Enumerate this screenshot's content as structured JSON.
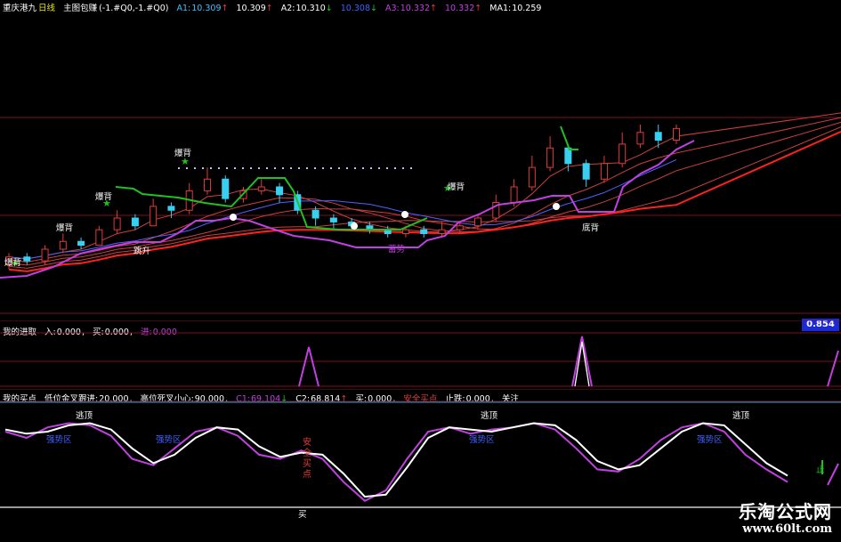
{
  "main_header": {
    "stock": "重庆港九",
    "period": "日线",
    "formula": "主图包赚",
    "params": "(-1.#Q0,-1.#Q0)",
    "a1_label": "A1:",
    "a1_value": "10.309",
    "a1_value2": "10.309",
    "a2_label": "A2:",
    "a2_value": "10.310",
    "blue_value": "10.308",
    "a3_label": "A3:",
    "a3_value": "10.332",
    "a3_value2": "10.332",
    "ma1_label": "MA1:",
    "ma1_value": "10.259"
  },
  "main_annotations": {
    "sell_label": "爆背",
    "buy_label": "底背",
    "rise_label": "跳升",
    "rebound_label": "蓄势"
  },
  "panel2": {
    "header": "我的进取",
    "in_label": "入:",
    "in_value": "0.000",
    "buy_label": "买:",
    "buy_value": "0.000",
    "enter_label": "进:",
    "enter_value": "0.000",
    "axis_value": "0.854"
  },
  "panel3": {
    "header": "我的买点",
    "low_golden_label": "低位金叉跟进:",
    "low_golden_value": "20.000",
    "high_dead_label": "高位死叉小心:",
    "high_dead_value": "90.000",
    "c1_label": "C1:",
    "c1_value": "69.104",
    "c2_label": "C2:",
    "c2_value": "68.814",
    "buy_label": "买:",
    "buy_value": "0.000",
    "safe_label": "安全买点",
    "stop_label": "止跌:",
    "stop_value": "0.000",
    "watch_label": "关注",
    "top_escape": "逃顶",
    "strong_label": "强势区",
    "safe_vertical": "安全买点",
    "buy_mark": "买",
    "small_mark": "止"
  },
  "watermark": {
    "site_name": "乐淘公式网",
    "url": "www.60lt.com"
  },
  "colors": {
    "background": "#000000",
    "up": "#e23a3a",
    "down": "#38d0f0",
    "magenta": "#c040e0",
    "white": "#ffffff",
    "green": "#20c020",
    "blue": "#4060ff",
    "separator": "#7a1020",
    "dotted": "#c0c0ff"
  },
  "chart_data": [
    {
      "type": "candlestick",
      "title": "",
      "candles": [
        {
          "o": 10.0,
          "c": 10.2,
          "h": 10.3,
          "l": 9.9
        },
        {
          "o": 10.2,
          "c": 10.1,
          "h": 10.3,
          "l": 10.0
        },
        {
          "o": 10.1,
          "c": 10.4,
          "h": 10.5,
          "l": 10.0
        },
        {
          "o": 10.4,
          "c": 10.6,
          "h": 10.8,
          "l": 10.3
        },
        {
          "o": 10.6,
          "c": 10.5,
          "h": 10.7,
          "l": 10.4
        },
        {
          "o": 10.5,
          "c": 10.9,
          "h": 11.0,
          "l": 10.5
        },
        {
          "o": 10.9,
          "c": 11.2,
          "h": 11.4,
          "l": 10.8
        },
        {
          "o": 11.2,
          "c": 11.0,
          "h": 11.3,
          "l": 10.9
        },
        {
          "o": 11.0,
          "c": 11.5,
          "h": 11.7,
          "l": 11.0
        },
        {
          "o": 11.5,
          "c": 11.4,
          "h": 11.6,
          "l": 11.2
        },
        {
          "o": 11.4,
          "c": 11.9,
          "h": 12.1,
          "l": 11.3
        },
        {
          "o": 11.9,
          "c": 12.2,
          "h": 12.5,
          "l": 11.8
        },
        {
          "o": 12.2,
          "c": 11.7,
          "h": 12.3,
          "l": 11.6
        },
        {
          "o": 11.7,
          "c": 11.9,
          "h": 12.0,
          "l": 11.6
        },
        {
          "o": 11.9,
          "c": 12.0,
          "h": 12.2,
          "l": 11.8
        },
        {
          "o": 12.0,
          "c": 11.8,
          "h": 12.1,
          "l": 11.6
        },
        {
          "o": 11.8,
          "c": 11.4,
          "h": 11.9,
          "l": 11.3
        },
        {
          "o": 11.4,
          "c": 11.2,
          "h": 11.5,
          "l": 11.0
        },
        {
          "o": 11.2,
          "c": 11.1,
          "h": 11.3,
          "l": 10.9
        },
        {
          "o": 11.1,
          "c": 11.0,
          "h": 11.2,
          "l": 10.9
        },
        {
          "o": 11.0,
          "c": 10.9,
          "h": 11.1,
          "l": 10.8
        },
        {
          "o": 10.9,
          "c": 10.8,
          "h": 11.0,
          "l": 10.7
        },
        {
          "o": 10.8,
          "c": 10.9,
          "h": 11.0,
          "l": 10.7
        },
        {
          "o": 10.9,
          "c": 10.8,
          "h": 11.0,
          "l": 10.7
        },
        {
          "o": 10.8,
          "c": 10.9,
          "h": 11.1,
          "l": 10.7
        },
        {
          "o": 10.9,
          "c": 11.0,
          "h": 11.1,
          "l": 10.8
        },
        {
          "o": 11.0,
          "c": 11.2,
          "h": 11.3,
          "l": 10.9
        },
        {
          "o": 11.2,
          "c": 11.6,
          "h": 11.8,
          "l": 11.1
        },
        {
          "o": 11.6,
          "c": 12.0,
          "h": 12.2,
          "l": 11.5
        },
        {
          "o": 12.0,
          "c": 12.5,
          "h": 12.8,
          "l": 11.9
        },
        {
          "o": 12.5,
          "c": 13.0,
          "h": 13.3,
          "l": 12.4
        },
        {
          "o": 13.0,
          "c": 12.6,
          "h": 13.1,
          "l": 12.4
        },
        {
          "o": 12.6,
          "c": 12.2,
          "h": 12.7,
          "l": 12.0
        },
        {
          "o": 12.2,
          "c": 12.6,
          "h": 12.8,
          "l": 12.1
        },
        {
          "o": 12.6,
          "c": 13.1,
          "h": 13.4,
          "l": 12.5
        },
        {
          "o": 13.1,
          "c": 13.4,
          "h": 13.6,
          "l": 13.0
        },
        {
          "o": 13.4,
          "c": 13.2,
          "h": 13.6,
          "l": 13.0
        },
        {
          "o": 13.2,
          "c": 13.5,
          "h": 13.6,
          "l": 13.1
        }
      ],
      "ylim": [
        9.6,
        13.6
      ]
    },
    {
      "type": "line",
      "title": "我的进取",
      "series": [
        {
          "name": "进",
          "values": [
            0,
            0,
            0,
            0,
            0,
            0,
            0,
            0,
            0,
            0,
            0,
            0,
            0,
            0,
            0,
            0,
            0,
            0,
            0,
            0,
            0,
            0,
            0,
            0,
            0,
            0,
            0,
            0,
            0,
            0,
            0,
            0,
            0,
            0,
            0,
            0,
            0,
            0.854
          ]
        }
      ],
      "ylim": [
        0,
        1
      ]
    },
    {
      "type": "line",
      "title": "我的买点",
      "series": [
        {
          "name": "C1",
          "values": [
            78,
            72,
            82,
            86,
            84,
            74,
            52,
            46,
            62,
            78,
            82,
            74,
            56,
            52,
            60,
            52,
            30,
            12,
            22,
            52,
            78,
            82,
            76,
            80,
            82,
            86,
            80,
            62,
            42,
            40,
            52,
            70,
            82,
            86,
            78,
            56,
            42,
            30
          ]
        },
        {
          "name": "C2",
          "values": [
            80,
            76,
            78,
            84,
            86,
            80,
            62,
            48,
            56,
            72,
            82,
            80,
            64,
            54,
            58,
            56,
            38,
            16,
            18,
            44,
            72,
            82,
            80,
            78,
            82,
            86,
            84,
            70,
            50,
            42,
            46,
            62,
            78,
            86,
            84,
            66,
            48,
            36
          ]
        }
      ],
      "ylim": [
        0,
        100
      ]
    }
  ]
}
